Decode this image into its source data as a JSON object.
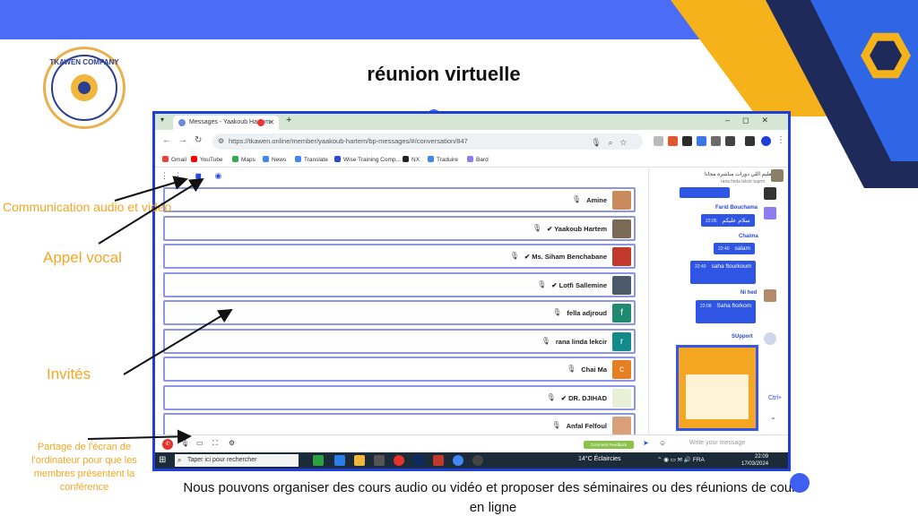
{
  "page": {
    "title": "réunion virtuelle",
    "caption": "Nous pouvons organiser des cours audio ou vidéo et proposer des séminaires ou des réunions de cours en ligne",
    "logo_text": "TKAWEN COMPANY"
  },
  "annotations": {
    "communication": "Communication audio et vidéo",
    "vocal": "Appel vocal",
    "guests": "Invités",
    "screen_share": "Partage de l'écran de l'ordinateur pour que les membres présentent la conférence"
  },
  "browser": {
    "tab_title": "Messages - Yaakoub Hartem",
    "new_tab_icon": "plus-icon",
    "url": "https://tkawen.online/member/yaakoub-hartem/bp-messages/#/conversation/847",
    "bookmarks": [
      "Gmail",
      "YouTube",
      "Maps",
      "News",
      "Translate",
      "Wise Training Comp...",
      "NX",
      "Traduire",
      "Bard"
    ]
  },
  "participants": [
    {
      "name": "Amine",
      "verified": false,
      "avatar_color": "#c98b5b",
      "avatar_letter": ""
    },
    {
      "name": "Yaakoub Hartem",
      "verified": true,
      "avatar_color": "#7a6a55",
      "avatar_letter": ""
    },
    {
      "name": "Ms. Siham Benchabane",
      "verified": true,
      "avatar_color": "#c0392b",
      "avatar_letter": ""
    },
    {
      "name": "Lotfi Sallemine",
      "verified": true,
      "avatar_color": "#4a5a6a",
      "avatar_letter": ""
    },
    {
      "name": "fella adjroud",
      "verified": false,
      "avatar_color": "#1f8a70",
      "avatar_letter": "f"
    },
    {
      "name": "rana linda lekcir",
      "verified": false,
      "avatar_color": "#138a8a",
      "avatar_letter": "r"
    },
    {
      "name": "Chai Ma",
      "verified": false,
      "avatar_color": "#e67e22",
      "avatar_letter": "c"
    },
    {
      "name": "DR. DJIHAD",
      "verified": true,
      "avatar_color": "#e8f0d8",
      "avatar_letter": ""
    },
    {
      "name": "Anfal Felfoul",
      "verified": false,
      "avatar_color": "#d9a07a",
      "avatar_letter": ""
    }
  ],
  "chat": {
    "top_text": "تعليم اللي دورات مباشرة مجانا",
    "top_sub": "rana linda lekcir tuprm",
    "messages": [
      {
        "sender": "Farid Bouchama",
        "time": "22:05",
        "text": "سلام عليكم"
      },
      {
        "sender": "Chaima",
        "time": "22:40",
        "text": "salam"
      },
      {
        "sender": "",
        "time": "22:40",
        "text": "saha ftourkoum"
      },
      {
        "sender": "Ni hed",
        "time": "22:08",
        "text": "Saha ftorkom"
      },
      {
        "sender": "SUpport",
        "time": "",
        "text": ""
      }
    ],
    "ctrl_label": "Ctrl+",
    "input_placeholder": "Write your message",
    "comment_label": "Comment Feedback"
  },
  "taskbar": {
    "search_placeholder": "Taper ici pour rechercher",
    "weather": "14°C  Éclaircies",
    "language": "FRA",
    "time": "22:09",
    "date": "17/03/2024"
  },
  "colors": {
    "accent": "#2f55e4",
    "annotation": "#f5a623",
    "frame": "#1f3fd8"
  }
}
